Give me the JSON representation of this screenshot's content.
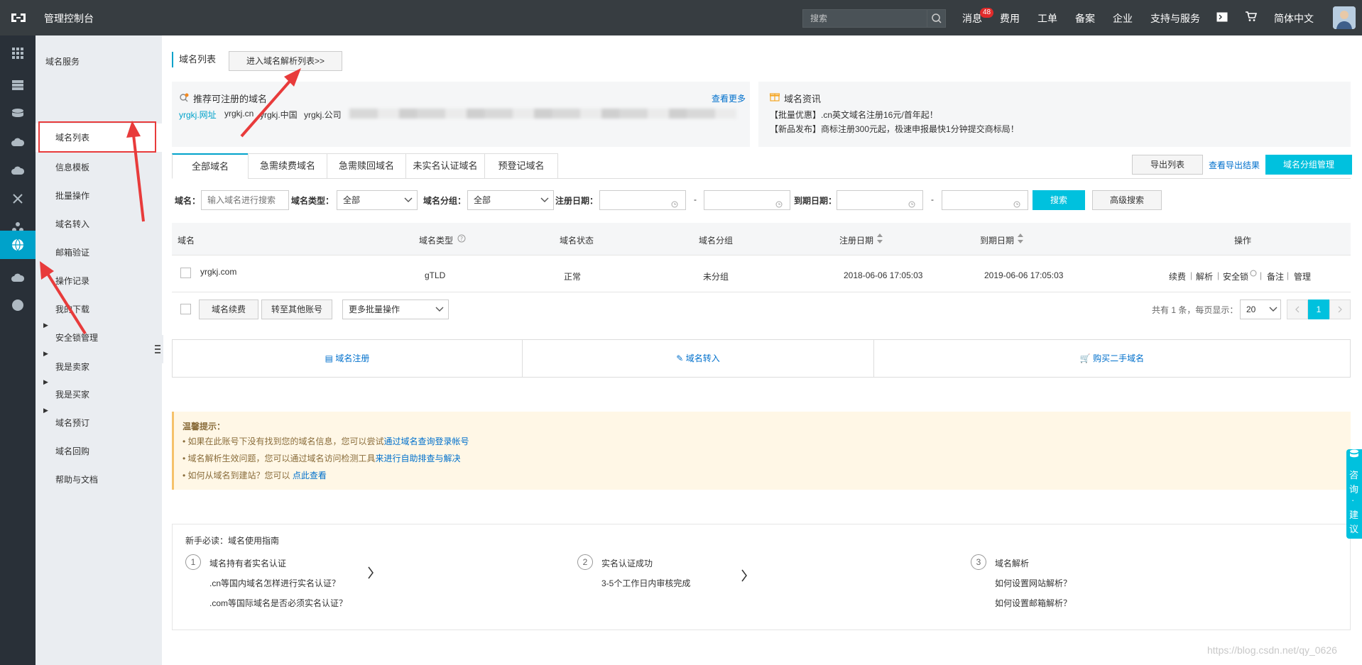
{
  "topbar": {
    "console_title": "管理控制台",
    "search_placeholder": "搜索",
    "nav": [
      "消息",
      "费用",
      "工单",
      "备案",
      "企业",
      "支持与服务",
      "简体中文"
    ],
    "message_badge": "48"
  },
  "sidebar": {
    "section_title": "域名服务",
    "items": [
      "域名列表",
      "信息模板",
      "批量操作",
      "域名转入",
      "邮箱验证",
      "操作记录",
      "我的下载",
      "安全锁管理"
    ],
    "expandable": [
      "我是卖家",
      "我是买家",
      "域名预订",
      "域名回购"
    ],
    "help": "帮助与文档"
  },
  "header": {
    "crumb": "域名列表",
    "go_dns_button": "进入域名解析列表>>"
  },
  "recommend": {
    "title": "推荐可注册的域名",
    "more": "查看更多",
    "domains": [
      "yrgkj.网址",
      "yrgkj.cn",
      "yrgkj.中国",
      "yrgkj.公司"
    ]
  },
  "news": {
    "title": "域名资讯",
    "items": [
      "【批量优惠】.cn英文域名注册16元/首年起！",
      "【新品发布】商标注册300元起，极速申报最快1分钟提交商标局！"
    ]
  },
  "tabs": [
    "全部域名",
    "急需续费域名",
    "急需赎回域名",
    "未实名认证域名",
    "预登记域名"
  ],
  "toolbar": {
    "export_list": "导出列表",
    "view_export": "查看导出结果",
    "group_manage": "域名分组管理"
  },
  "filters": {
    "domain_label": "域名：",
    "domain_placeholder": "输入域名进行搜索",
    "type_label": "域名类型：",
    "type_value": "全部",
    "group_label": "域名分组：",
    "group_value": "全部",
    "reg_date_label": "注册日期：",
    "exp_date_label": "到期日期：",
    "dash": "-",
    "search_button": "搜索",
    "advanced_button": "高级搜索"
  },
  "table": {
    "headers": [
      "域名",
      "域名类型",
      "域名状态",
      "域名分组",
      "注册日期",
      "到期日期",
      "操作"
    ],
    "rows": [
      {
        "domain": "yrgkj.com",
        "type": "gTLD",
        "status": "正常",
        "group": "未分组",
        "reg_date": "2018-06-06 17:05:03",
        "exp_date": "2019-06-06 17:05:03",
        "actions": [
          "续费",
          "解析",
          "安全锁",
          "备注",
          "管理"
        ]
      }
    ]
  },
  "bulk": {
    "renew_button": "域名续费",
    "transfer_button": "转至其他账号",
    "more_ops": "更多批量操作",
    "pagination_text": "共有 1 条，每页显示：",
    "page_size": "20",
    "current_page": "1"
  },
  "quick_links": [
    "域名注册",
    "域名转入",
    "购买二手域名"
  ],
  "tips": {
    "title": "温馨提示：",
    "lines": [
      {
        "text": "• 如果在此账号下没有找到您的域名信息，您可以尝试",
        "link": "通过域名查询登录帐号"
      },
      {
        "text": "• 域名解析生效问题，您可以通过域名访问检测工具",
        "link": "来进行自助排查与解决"
      },
      {
        "text": "• 如何从域名到建站？您可以 ",
        "link": "点此查看"
      }
    ]
  },
  "guide": {
    "title": "新手必读：域名使用指南",
    "steps": [
      {
        "num": "1",
        "title": "域名持有者实名认证",
        "lines": [
          ".cn等国内域名怎样进行实名认证？",
          ".com等国际域名是否必须实名认证？"
        ]
      },
      {
        "num": "2",
        "title": "实名认证成功",
        "lines": [
          "3-5个工作日内审核完成"
        ]
      },
      {
        "num": "3",
        "title": "域名解析",
        "lines": [
          "如何设置网站解析？",
          "如何设置邮箱解析？"
        ]
      }
    ]
  },
  "consult": [
    "咨",
    "询",
    "·",
    "建",
    "议"
  ],
  "watermark": "https://blog.csdn.net/qy_0626"
}
